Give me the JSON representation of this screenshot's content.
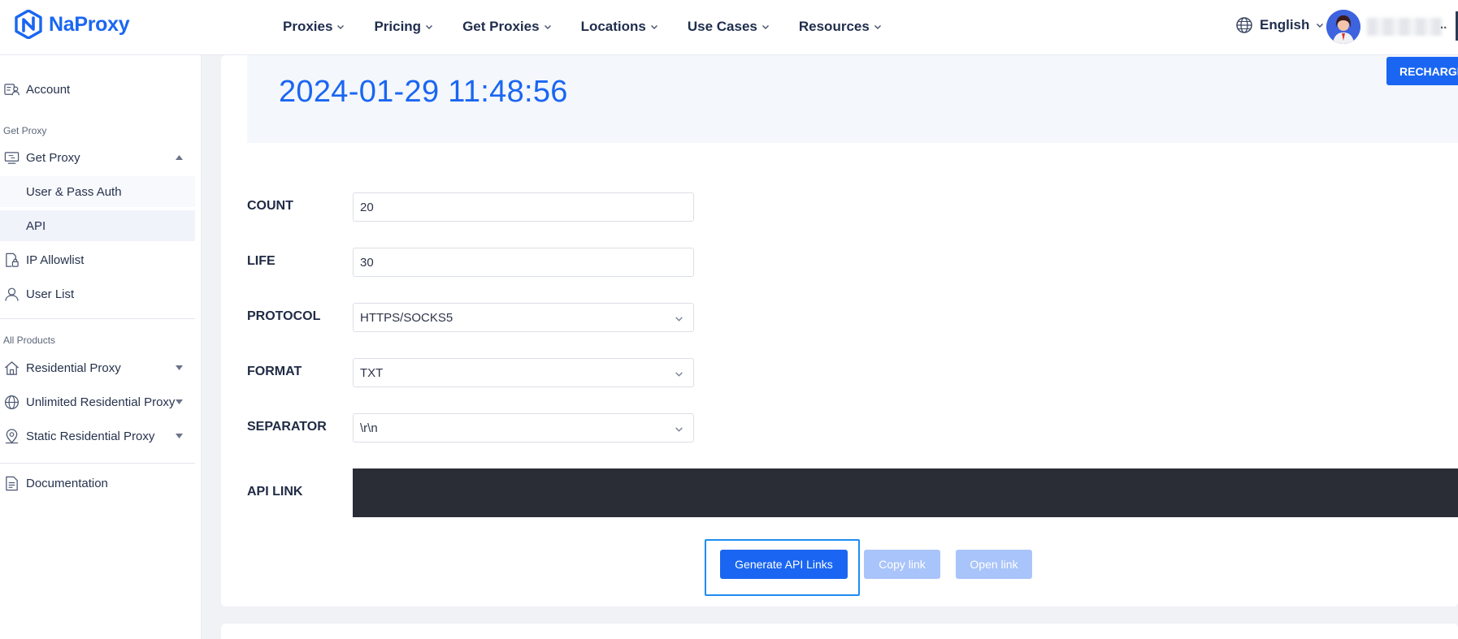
{
  "brand": {
    "name": "NaProxy",
    "color": "#1a66f2"
  },
  "nav": {
    "items": [
      {
        "label": "Proxies"
      },
      {
        "label": "Pricing"
      },
      {
        "label": "Get Proxies"
      },
      {
        "label": "Locations"
      },
      {
        "label": "Use Cases"
      },
      {
        "label": "Resources"
      }
    ],
    "language": "English",
    "user_suffix": ".."
  },
  "sidebar": {
    "account": "Account",
    "group_get_proxy": "Get Proxy",
    "get_proxy": "Get Proxy",
    "user_pass_auth": "User & Pass Auth",
    "api": "API",
    "ip_allowlist": "IP Allowlist",
    "user_list": "User List",
    "group_all_products": "All Products",
    "residential_proxy": "Residential Proxy",
    "unlimited_residential_proxy": "Unlimited Residential Proxy",
    "static_residential_proxy": "Static Residential Proxy",
    "documentation": "Documentation"
  },
  "main": {
    "timestamp": "2024-01-29 11:48:56",
    "recharge_label": "RECHARGE",
    "form": {
      "count_label": "COUNT",
      "count_value": "20",
      "life_label": "LIFE",
      "life_value": "30",
      "protocol_label": "PROTOCOL",
      "protocol_value": "HTTPS/SOCKS5",
      "format_label": "FORMAT",
      "format_value": "TXT",
      "separator_label": "SEPARATOR",
      "separator_value": "\\r\\n",
      "api_link_label": "API LINK"
    },
    "buttons": {
      "generate": "Generate API Links",
      "copy": "Copy link",
      "open": "Open link"
    }
  }
}
